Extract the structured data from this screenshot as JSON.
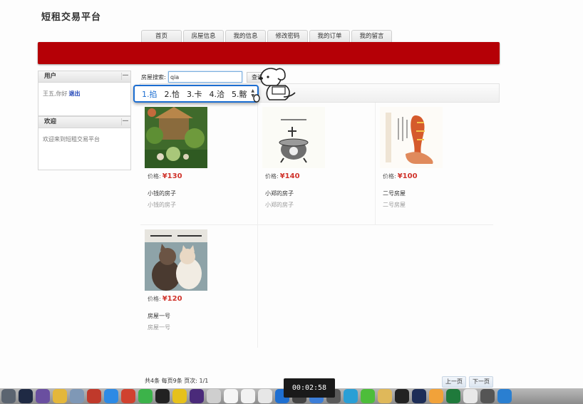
{
  "site": {
    "title": "短租交易平台"
  },
  "nav": {
    "tabs": [
      "首页",
      "房屋信息",
      "我的信息",
      "修改密码",
      "我的订单",
      "我的留言"
    ]
  },
  "sidebar": {
    "user_panel": {
      "title": "用户",
      "greeting": "王五,你好",
      "logout": "退出"
    },
    "welcome_panel": {
      "title": "欢迎",
      "text": "欢迎来到短租交易平台"
    },
    "collapse_symbol": "—"
  },
  "search": {
    "label": "房屋搜索:",
    "value": "qia",
    "button": "查询"
  },
  "ime": {
    "candidates": [
      "1.掐",
      "2.恰",
      "3.卡",
      "4.洽",
      "5.髂"
    ]
  },
  "listings": [
    {
      "price_label": "价格:",
      "price": "¥130",
      "title": "小钱的房子",
      "subtitle": "小钱的房子",
      "image": "plant-garden-photo"
    },
    {
      "price_label": "价格:",
      "price": "¥140",
      "title": "小郑的房子",
      "subtitle": "小郑的房子",
      "image": "cartoon-pot-sketch"
    },
    {
      "price_label": "价格:",
      "price": "¥100",
      "title": "二号房屋",
      "subtitle": "二号房屋",
      "image": "hand-holding-vase-drawing"
    },
    {
      "price_label": "价格:",
      "price": "¥120",
      "title": "房屋一号",
      "subtitle": "房屋一号",
      "image": "two-cats-photo"
    }
  ],
  "pager": {
    "info": "共4条 每页9条 页次: 1/1",
    "prev": "上一页",
    "next": "下一页"
  },
  "video_timer": "00:02:58",
  "colors": {
    "banner": "#b50006",
    "price": "#d0342c",
    "ime_border": "#1b6dd1"
  }
}
